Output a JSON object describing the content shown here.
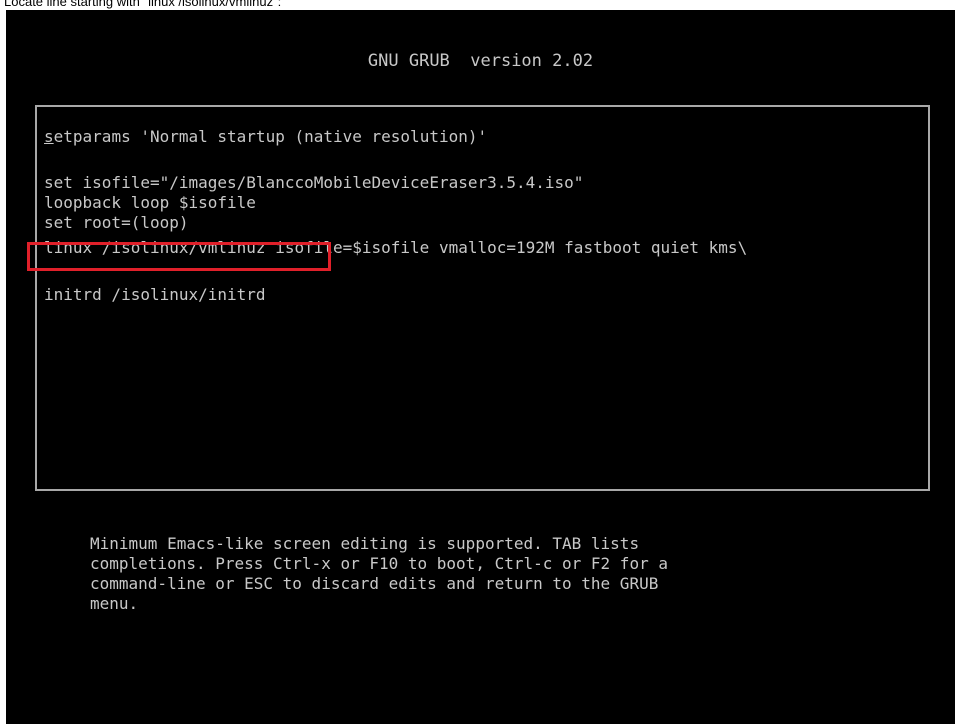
{
  "caption": "Locate line starting with \"linux /isolinux/vmlinuz\":",
  "grub": {
    "header": "GNU GRUB  version 2.02",
    "editor": {
      "lines": [
        {
          "cursor_char": "s",
          "rest": "etparams 'Normal startup (native resolution)'"
        },
        {
          "text": "set isofile=\"/images/BlanccoMobileDeviceEraser3.5.4.iso\""
        },
        {
          "text": "loopback loop $isofile"
        },
        {
          "text": "set root=(loop)"
        },
        {
          "text": "linux /isolinux/vmlinuz isofile=$isofile vmalloc=192M fastboot quiet kms\\"
        },
        {
          "text": "initrd /isolinux/initrd"
        }
      ]
    },
    "help": "Minimum Emacs-like screen editing is supported. TAB lists\ncompletions. Press Ctrl-x or F10 to boot, Ctrl-c or F2 for a\ncommand-line or ESC to discard edits and return to the GRUB\nmenu."
  },
  "colors": {
    "screen_bg": "#000000",
    "text": "#c8c8c8",
    "border": "#a8a8a8",
    "highlight": "#e0202a"
  }
}
